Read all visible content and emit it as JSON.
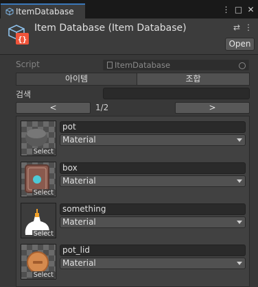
{
  "tab": {
    "title": "ItemDatabase"
  },
  "window_buttons": [
    "⋮",
    "□",
    "✕"
  ],
  "header": {
    "title": "Item Database (Item Database)",
    "sliders_icon": "⇄",
    "menu_icon": "⋮",
    "open_label": "Open"
  },
  "script": {
    "label": "Script",
    "value": "ItemDatabase"
  },
  "tabs": [
    "아이템",
    "조합"
  ],
  "search": {
    "label": "검색",
    "value": ""
  },
  "pager": {
    "prev": "<",
    "text": "1/2",
    "next": ">"
  },
  "items": [
    {
      "name": "pot",
      "type": "Material",
      "select": "Select"
    },
    {
      "name": "box",
      "type": "Material",
      "select": "Select"
    },
    {
      "name": "something",
      "type": "Material",
      "select": "Select"
    },
    {
      "name": "pot_lid",
      "type": "Material",
      "select": "Select"
    }
  ],
  "colors": {
    "tab_accent": "#3a79bb",
    "script_icon": "#f0543a",
    "brackets": "#4ba3e0"
  }
}
